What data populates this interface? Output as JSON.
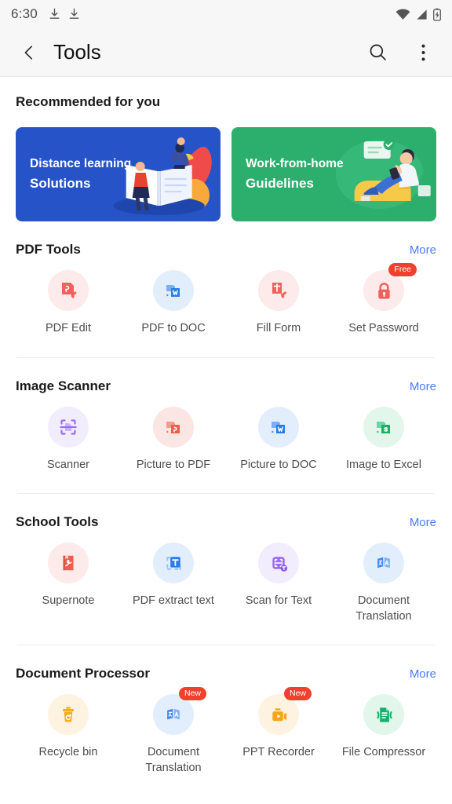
{
  "status_bar": {
    "time": "6:30",
    "left_icons": [
      "download-icon",
      "download-icon"
    ],
    "right_icons": [
      "wifi-icon",
      "cellular-signal-icon",
      "battery-charging-icon"
    ]
  },
  "header": {
    "back_icon": "chevron-left-icon",
    "title": "Tools",
    "search_icon": "search-icon",
    "overflow_icon": "more-vertical-icon"
  },
  "recommended": {
    "title": "Recommended for you",
    "banners": [
      {
        "line1": "Distance learning",
        "line2": "Solutions",
        "color": "#2753c8",
        "art": "distance-learning-illustration"
      },
      {
        "line1": "Work-from-home",
        "line2": "Guidelines",
        "color": "#2cae6d",
        "art": "work-from-home-illustration"
      }
    ]
  },
  "more_label": "More",
  "sections": [
    {
      "title": "PDF Tools",
      "tools": [
        {
          "label": "PDF Edit",
          "icon": "pdf-edit-icon",
          "bg": "#fdeaea",
          "fg": "#f0605c",
          "badge": ""
        },
        {
          "label": "PDF to DOC",
          "icon": "pdf-to-doc-icon",
          "bg": "#e3eefd",
          "fg": "#4a8cf7",
          "badge": ""
        },
        {
          "label": "Fill Form",
          "icon": "fill-form-icon",
          "bg": "#fdeaea",
          "fg": "#f0605c",
          "badge": ""
        },
        {
          "label": "Set Password",
          "icon": "lock-icon",
          "bg": "#fdeaea",
          "fg": "#f0605c",
          "badge": "Free"
        }
      ]
    },
    {
      "title": "Image Scanner",
      "tools": [
        {
          "label": "Scanner",
          "icon": "scanner-icon",
          "bg": "#f2edfd",
          "fg": "#9b6cf2",
          "badge": ""
        },
        {
          "label": "Picture to PDF",
          "icon": "picture-to-pdf-icon",
          "bg": "#fce6e3",
          "fg": "#ef5d50",
          "badge": ""
        },
        {
          "label": "Picture to DOC",
          "icon": "picture-to-doc-icon",
          "bg": "#e3eefd",
          "fg": "#2b7ced",
          "badge": ""
        },
        {
          "label": "Image to Excel",
          "icon": "image-to-excel-icon",
          "bg": "#e2f6ec",
          "fg": "#16b364",
          "badge": ""
        }
      ]
    },
    {
      "title": "School Tools",
      "tools": [
        {
          "label": "Supernote",
          "icon": "supernote-icon",
          "bg": "#fdeaea",
          "fg": "#ef5d50",
          "badge": ""
        },
        {
          "label": "PDF extract text",
          "icon": "extract-text-icon",
          "bg": "#e3eefd",
          "fg": "#2b7ced",
          "badge": ""
        },
        {
          "label": "Scan for Text",
          "icon": "scan-for-text-icon",
          "bg": "#f2edfd",
          "fg": "#9b6cf2",
          "badge": ""
        },
        {
          "label": "Document\nTranslation",
          "icon": "translation-icon",
          "bg": "#e3eefd",
          "fg": "#2b7ced",
          "badge": ""
        }
      ]
    },
    {
      "title": "Document Processor",
      "tools": [
        {
          "label": "Recycle bin",
          "icon": "recycle-bin-icon",
          "bg": "#fdf3e0",
          "fg": "#f9ab18",
          "badge": ""
        },
        {
          "label": "Document\nTranslation",
          "icon": "translation-icon",
          "bg": "#e3eefd",
          "fg": "#2b7ced",
          "badge": "New"
        },
        {
          "label": "PPT Recorder",
          "icon": "ppt-recorder-icon",
          "bg": "#fdf3e0",
          "fg": "#f9a41a",
          "badge": "New"
        },
        {
          "label": "File Compressor",
          "icon": "file-compressor-icon",
          "bg": "#e2f6ec",
          "fg": "#0fb36a",
          "badge": ""
        }
      ]
    }
  ]
}
